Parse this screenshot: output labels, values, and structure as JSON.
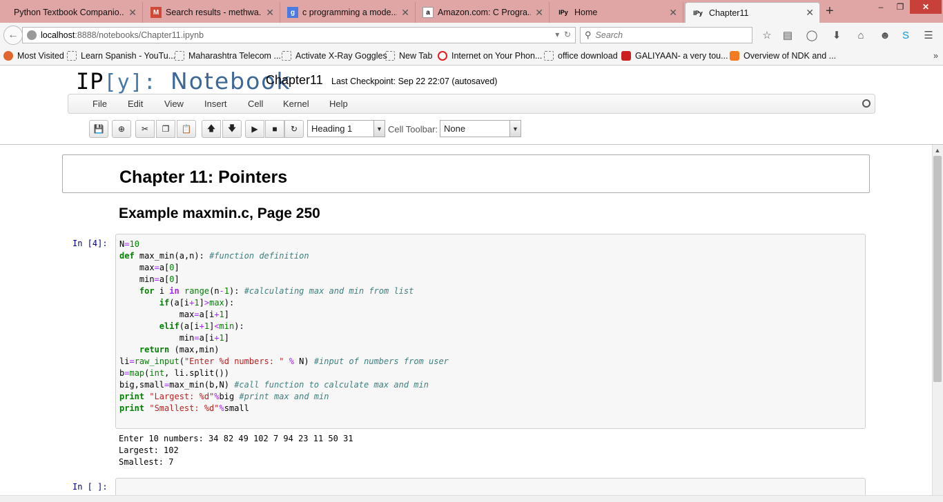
{
  "browser": {
    "tabs": [
      {
        "title": "Python Textbook Companio...",
        "favicon": "python-icon",
        "active": false
      },
      {
        "title": "Search results - methwa...",
        "favicon": "gmail-icon",
        "active": false
      },
      {
        "title": "c programming a mode...",
        "favicon": "google-icon",
        "active": false
      },
      {
        "title": "Amazon.com: C Progra...",
        "favicon": "amazon-icon",
        "active": false
      },
      {
        "title": "Home",
        "favicon": "ipython-icon",
        "active": false
      },
      {
        "title": "Chapter11",
        "favicon": "ipython-icon",
        "active": true
      }
    ],
    "url_host": "localhost",
    "url_path": ":8888/notebooks/Chapter11.ipynb",
    "search_placeholder": "Search",
    "bookmarks": [
      {
        "label": "Most Visited",
        "icon": "firefox-icon"
      },
      {
        "label": "Learn Spanish - YouTu...",
        "icon": "page-icon"
      },
      {
        "label": "Maharashtra Telecom ...",
        "icon": "page-icon"
      },
      {
        "label": "Activate X-Ray Goggles",
        "icon": "page-icon"
      },
      {
        "label": "New Tab",
        "icon": "page-icon"
      },
      {
        "label": "Internet on Your Phon...",
        "icon": "opera-icon"
      },
      {
        "label": "office download",
        "icon": "page-icon"
      },
      {
        "label": "GALIYAAN- a very tou...",
        "icon": "youtube-icon"
      },
      {
        "label": "Overview of NDK and ...",
        "icon": "blogger-icon"
      }
    ]
  },
  "notebook": {
    "logo_ip": "IP",
    "logo_y": "[y]:",
    "logo_notebook": "Notebook",
    "name": "Chapter11",
    "checkpoint": "Last Checkpoint: Sep 22 22:07 (autosaved)",
    "menu": [
      "File",
      "Edit",
      "View",
      "Insert",
      "Cell",
      "Kernel",
      "Help"
    ],
    "cell_type": "Heading 1",
    "cell_toolbar_label": "Cell Toolbar:",
    "cell_toolbar_value": "None"
  },
  "cells": {
    "heading1": "Chapter 11: Pointers",
    "heading2": "Example maxmin.c, Page 250",
    "code_prompt": "In [4]:",
    "output_lines": [
      "Enter 10 numbers: 34 82 49 102 7 94 23 11 50 31",
      "Largest: 102",
      "Smallest: 7"
    ],
    "empty_prompt": "In [ ]:"
  }
}
